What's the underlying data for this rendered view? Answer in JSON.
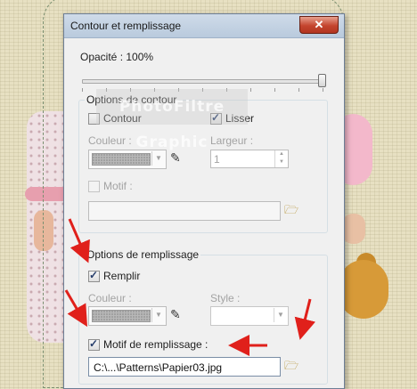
{
  "dialog": {
    "title": "Contour et remplissage",
    "close_symbol": "✕"
  },
  "opacity": {
    "label": "Opacité : 100%",
    "value_percent": 100
  },
  "stroke_options": {
    "group_title": "Options de contour",
    "contour_label": "Contour",
    "contour_checked": false,
    "lisser_label": "Lisser",
    "lisser_checked": true,
    "couleur_label": "Couleur :",
    "largeur_label": "Largeur :",
    "largeur_value": "1",
    "motif_label": "Motif :",
    "motif_checked": false,
    "motif_path": ""
  },
  "fill_options": {
    "group_title": "Options de remplissage",
    "remplir_label": "Remplir",
    "remplir_checked": true,
    "couleur_label": "Couleur :",
    "style_label": "Style :",
    "style_value": "",
    "motif_remplissage_label": "Motif de remplissage :",
    "motif_remplissage_checked": true,
    "motif_path": "C:\\...\\Patterns\\Papier03.jpg"
  },
  "watermark": {
    "text": "PhotoFiltre Graphic"
  },
  "icons": {
    "eyedropper": "eyedropper-icon",
    "folder": "folder-open-icon",
    "arrow": "red-arrow-annotation"
  },
  "colors": {
    "annotation_red": "#e0201b",
    "close_red": "#c4452f",
    "title_blue": "#c6d5e6"
  }
}
